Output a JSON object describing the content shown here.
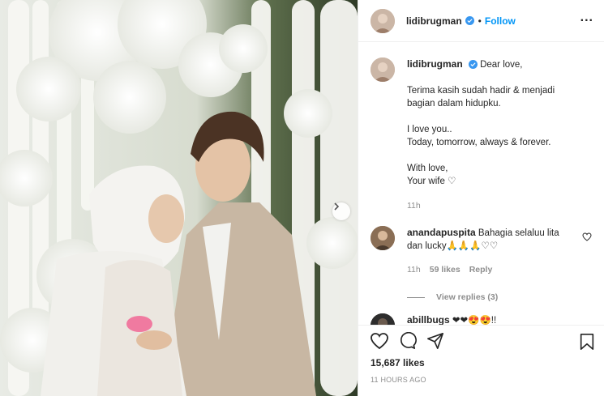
{
  "post": {
    "username": "lidibrugman",
    "follow_label": "Follow",
    "separator": "•",
    "more_label": "...",
    "caption": {
      "lines": [
        "Dear love,",
        "Terima kasih sudah hadir & menjadi",
        "bagian dalam hidupku.",
        "I love you..",
        "Today, tomorrow, always & forever.",
        "With love,",
        "Your wife ♡"
      ],
      "time": "11h"
    },
    "comments": [
      {
        "username": "anandapuspita",
        "text": "Bahagia selaluu lita dan lucky🙏🙏🙏♡♡",
        "time": "11h",
        "likes": "59 likes",
        "reply_label": "Reply",
        "view_replies": "View replies (3)"
      },
      {
        "username": "abillbugs",
        "text": "❤❤😍😍!!"
      }
    ],
    "likes_count": "15,687 likes",
    "timestamp": "11 HOURS AGO"
  },
  "icons": {
    "verified": "verified-badge-icon",
    "like": "heart-icon",
    "comment": "comment-icon",
    "share": "share-icon",
    "save": "bookmark-icon",
    "next": "chevron-right-icon"
  },
  "colors": {
    "accent": "#0095f6",
    "verified": "#3897f0",
    "muted": "#8e8e8e",
    "text": "#262626"
  }
}
